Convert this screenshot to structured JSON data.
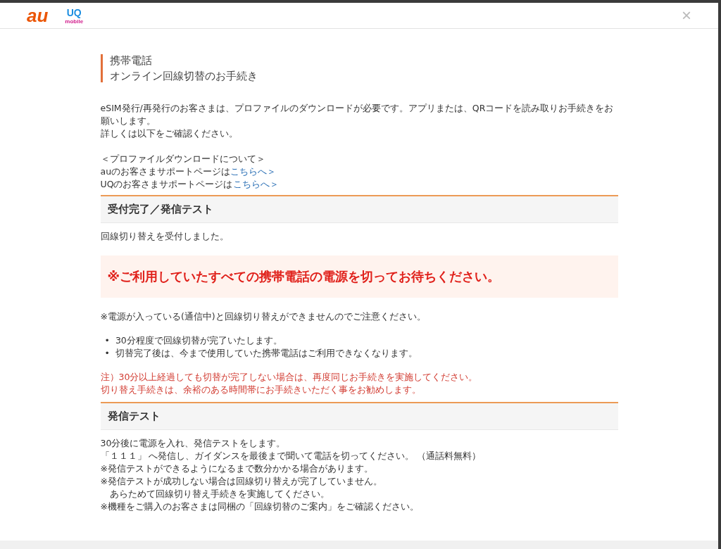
{
  "header": {
    "logo_main": "au",
    "logo_sub_top": "UQ",
    "logo_sub_bottom": "mobile",
    "close": "×"
  },
  "title": {
    "lines": [
      "携帯電話",
      "オンライン回線切替のお手続き"
    ]
  },
  "intro": {
    "lines": [
      "eSIM発行/再発行のお客さまは、プロファイルのダウンロードが必要です。アプリまたは、QRコードを読み取りお手続きをお願いします。",
      "詳しくは以下をご確認ください。"
    ],
    "download_heading": "＜プロファイルダウンロードについて＞",
    "support_links": [
      {
        "text": "auのお客さまサポートページは",
        "link": "こちらへ＞"
      },
      {
        "text": "UQのお客さまサポートページは",
        "link": "こちらへ＞"
      }
    ]
  },
  "sections": [
    {
      "heading": "受付完了／発信テスト",
      "blocks": [
        {
          "kind": "text",
          "lines": [
            "回線切り替えを受付しました。"
          ]
        },
        {
          "kind": "alert",
          "lines": [
            "※ご利用していたすべての携帯電話の電源を切ってお待ちください。"
          ]
        },
        {
          "kind": "text",
          "lines": [
            "※電源が入っている(通信中)と回線切り替えができませんのでご注意ください。"
          ]
        },
        {
          "kind": "bullets",
          "marker": "•",
          "lines": [
            "30分程度で回線切替が完了いたします。",
            "切替完了後は、今まで使用していた携帯電話はご利用できなくなります。"
          ]
        },
        {
          "kind": "note",
          "lines": [
            "注）30分以上経過しても切替が完了しない場合は、再度同じお手続きを実施してください。",
            "切り替え手続きは、余裕のある時間帯にお手続きいただく事をお勧めします。"
          ]
        }
      ]
    },
    {
      "heading": "発信テスト",
      "blocks": [
        {
          "kind": "text",
          "lines": [
            "30分後に電源を入れ、発信テストをします。",
            "「１１１」 へ発信し、ガイダンスを最後まで聞いて電話を切ってください。 （通話料無料）",
            "※発信テストができるようになるまで数分かかる場合があります。",
            "※発信テストが成功しない場合は回線切り替えが完了していません。",
            "　あらためて回線切り替え手続きを実施してください。",
            "※機種をご購入のお客さまは同梱の「回線切替のご案内」をご確認ください。"
          ]
        }
      ]
    }
  ]
}
